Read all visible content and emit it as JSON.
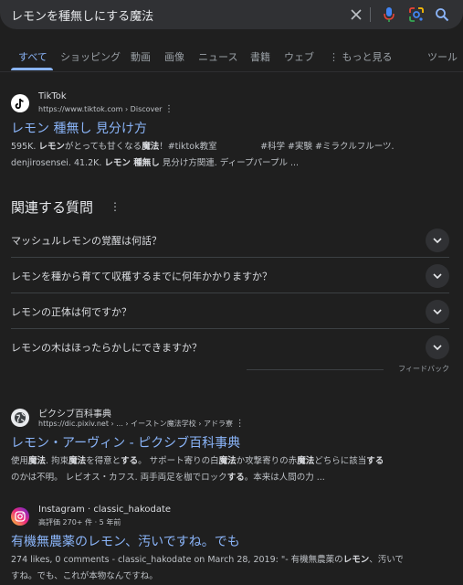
{
  "search": {
    "query": "レモンを種無しにする魔法"
  },
  "tabs": [
    "すべて",
    "ショッピング",
    "動画",
    "画像",
    "ニュース",
    "書籍",
    "ウェブ",
    "もっと見る"
  ],
  "tools_label": "ツール",
  "results": [
    {
      "site": "TikTok",
      "url": "https://www.tiktok.com › Discover",
      "title": "レモン 種無し 見分け方",
      "snippet_line1_html": "595K. <b>レモン</b>がとっても甘くなる<b>魔法</b>！#tiktok教室　　　　　#科学 #実験 #ミラクルフルーツ.",
      "snippet_line2_html": "denjirosensei. 41.2K. <b>レモン 種無し</b> 見分け方関連. ディープパープル ..."
    },
    {
      "site": "ピクシブ百科事典",
      "url": "https://dic.pixiv.net › ... › イーストン魔法学校 › アドラ寮",
      "title": "レモン・アーヴィン - ピクシブ百科事典",
      "snippet_line1_html": "使用<b>魔法</b>. 拘束<b>魔法</b>を得意と<b>する</b>。 サポート寄りの白<b>魔法</b>か攻撃寄りの赤<b>魔法</b>どちらに該当<b>する</b>",
      "snippet_line2_html": "のかは不明。 レビオス・カフス. 両手両足を枷でロック<b>する</b>。本来は人間の力 ..."
    },
    {
      "site": "Instagram · classic_hakodate",
      "url": "高評価 270+ 件 · 5 年前",
      "title": "有機無農薬のレモン、汚いですね。でも",
      "snippet_line1_html": "274 likes, 0 comments - classic_hakodate on March 28, 2019: \"- 有機無農薬の<b>レモン</b>、汚いで",
      "snippet_line2_html": "すね。でも、これが本物なんですね。"
    }
  ],
  "paa": {
    "title": "関連する質問",
    "questions": [
      "マッシュルレモンの覚醒は何話？",
      "レモンを種から育てて収穫するまでに何年かかりますか？",
      "レモンの正体は何ですか？",
      "レモンの木はほったらかしにできますか？"
    ],
    "feedback": "フィードバック"
  }
}
